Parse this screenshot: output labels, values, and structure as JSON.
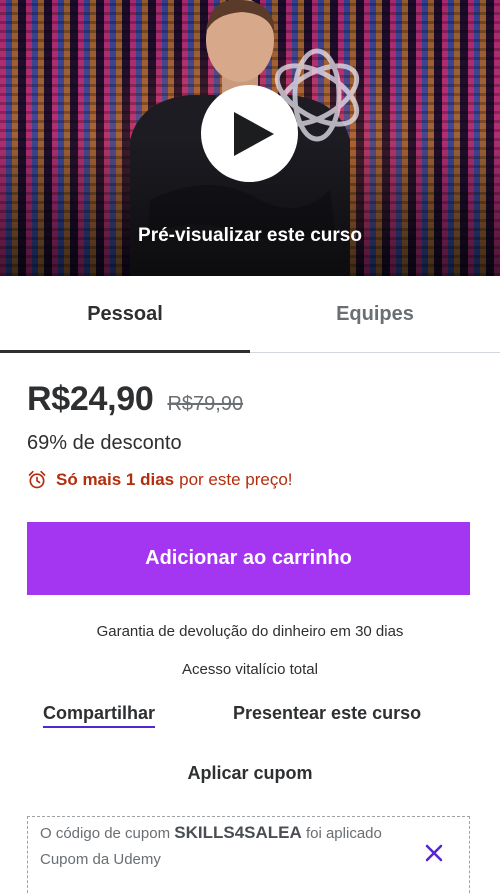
{
  "preview": {
    "label": "Pré-visualizar este curso",
    "play_icon": "play-icon",
    "logo_icon": "openai-knot-logo"
  },
  "tabs": [
    {
      "label": "Pessoal",
      "active": true
    },
    {
      "label": "Equipes",
      "active": false
    }
  ],
  "pricing": {
    "current_price": "R$24,90",
    "original_price": "R$79,90",
    "discount_text": "69% de desconto",
    "deadline_bold": "Só mais 1 dias",
    "deadline_rest": "por este preço!",
    "deadline_icon": "alarm-clock-icon"
  },
  "actions": {
    "add_to_cart": "Adicionar ao carrinho",
    "guarantee": "Garantia de devolução do dinheiro em 30 dias",
    "lifetime": "Acesso vitalício total",
    "share": "Compartilhar",
    "gift": "Presentear este curso",
    "apply_coupon": "Aplicar cupom"
  },
  "coupon": {
    "prefix": "O código de cupom",
    "code": "SKILLS4SALEA",
    "suffix": "foi aplicado",
    "source": "Cupom da Udemy",
    "remove_icon": "close-icon"
  },
  "colors": {
    "accent": "#a435f0",
    "urgency": "#b32d0f",
    "link_underline": "#5624d0",
    "text": "#2d2f31",
    "muted": "#6a6f73"
  }
}
